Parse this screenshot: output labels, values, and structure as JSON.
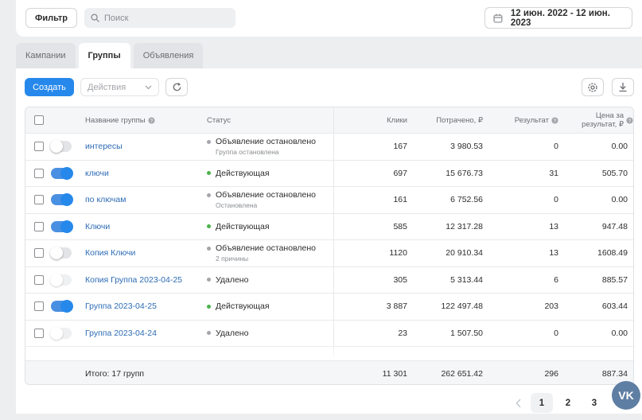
{
  "toolbar": {
    "filter_label": "Фильтр",
    "search_placeholder": "Поиск",
    "date_range": "12 июн. 2022 - 12 июн. 2023"
  },
  "tabs": [
    {
      "label": "Кампании",
      "active": false
    },
    {
      "label": "Группы",
      "active": true
    },
    {
      "label": "Объявления",
      "active": false
    }
  ],
  "actions": {
    "create_label": "Создать",
    "actions_label": "Действия"
  },
  "table": {
    "columns": {
      "name": "Название группы",
      "status": "Статус",
      "clicks": "Клики",
      "spent": "Потрачено, ₽",
      "result": "Результат",
      "cpr_line1": "Цена за",
      "cpr_line2": "результат, ₽"
    },
    "rows": [
      {
        "name": "интересы",
        "toggle": "off",
        "status": "Объявление остановлено",
        "dot": "#a3a6aa",
        "sub": "Группа остановлена",
        "clicks": "167",
        "spent": "3 980.53",
        "result": "0",
        "cpr": "0.00"
      },
      {
        "name": "ключи",
        "toggle": "on",
        "status": "Действующая",
        "dot": "#4bb34b",
        "sub": "",
        "clicks": "697",
        "spent": "15 676.73",
        "result": "31",
        "cpr": "505.70"
      },
      {
        "name": "по ключам",
        "toggle": "on",
        "status": "Объявление остановлено",
        "dot": "#a3a6aa",
        "sub": "Остановлена",
        "clicks": "161",
        "spent": "6 752.56",
        "result": "0",
        "cpr": "0.00"
      },
      {
        "name": "Ключи",
        "toggle": "on",
        "status": "Действующая",
        "dot": "#4bb34b",
        "sub": "",
        "clicks": "585",
        "spent": "12 317.28",
        "result": "13",
        "cpr": "947.48"
      },
      {
        "name": "Копия Ключи",
        "toggle": "off",
        "status": "Объявление остановлено",
        "dot": "#a3a6aa",
        "sub": "2 причины",
        "clicks": "1120",
        "spent": "20 910.34",
        "result": "13",
        "cpr": "1608.49"
      },
      {
        "name": "Копия Группа 2023-04-25",
        "toggle": "off-light",
        "status": "Удалено",
        "dot": "#a3a6aa",
        "sub": "",
        "clicks": "305",
        "spent": "5 313.44",
        "result": "6",
        "cpr": "885.57"
      },
      {
        "name": "Группа 2023-04-25",
        "toggle": "on",
        "status": "Действующая",
        "dot": "#4bb34b",
        "sub": "",
        "clicks": "3 887",
        "spent": "122 497.48",
        "result": "203",
        "cpr": "603.44"
      },
      {
        "name": "Группа 2023-04-24",
        "toggle": "off-light",
        "status": "Удалено",
        "dot": "#a3a6aa",
        "sub": "",
        "clicks": "23",
        "spent": "1 507.50",
        "result": "0",
        "cpr": "0.00"
      }
    ],
    "footer": {
      "total_label": "Итого: 17 групп",
      "clicks": "11 301",
      "spent": "262 651.42",
      "result": "296",
      "cpr": "887.34"
    }
  },
  "pagination": {
    "pages": [
      "1",
      "2",
      "3"
    ],
    "active": "1"
  },
  "vk_logo": "VK"
}
